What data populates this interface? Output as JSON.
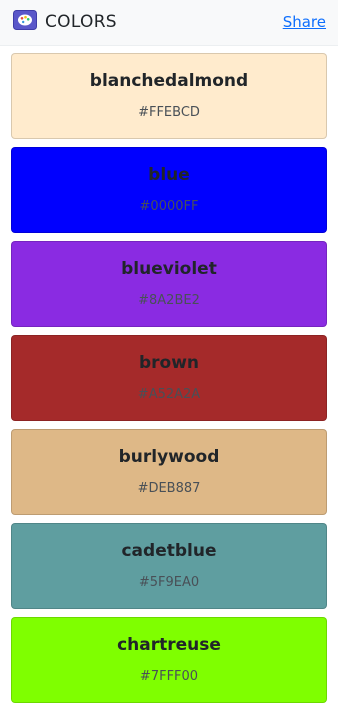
{
  "header": {
    "title": "COLORS",
    "share_label": "Share",
    "icon": "palette-icon"
  },
  "colors": [
    {
      "name": "blanchedalmond",
      "hex": "#FFEBCD",
      "swatch": "#FFEBCD"
    },
    {
      "name": "blue",
      "hex": "#0000FF",
      "swatch": "#0000FF"
    },
    {
      "name": "blueviolet",
      "hex": "#8A2BE2",
      "swatch": "#8A2BE2"
    },
    {
      "name": "brown",
      "hex": "#A52A2A",
      "swatch": "#A52A2A"
    },
    {
      "name": "burlywood",
      "hex": "#DEB887",
      "swatch": "#DEB887"
    },
    {
      "name": "cadetblue",
      "hex": "#5F9EA0",
      "swatch": "#5F9EA0"
    },
    {
      "name": "chartreuse",
      "hex": "#7FFF00",
      "swatch": "#7FFF00"
    }
  ]
}
